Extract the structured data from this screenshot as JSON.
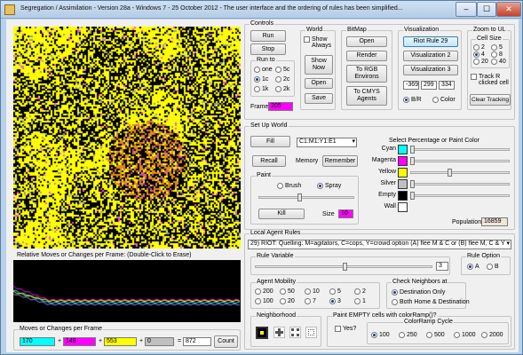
{
  "window": {
    "title": "Segregation / Assimilation - Version 28a - Windows 7 - 25 October 2012 - The user interface and the ordering of rules has been simplified...",
    "minimize": "–",
    "maximize": "☐",
    "close": "✕"
  },
  "graph": {
    "label": "Relative Moves or Changes per Frame:  (Double-Click to Erase)"
  },
  "moves": {
    "label": "Moves or Changes per Frame",
    "v1": "170",
    "plus1": "+",
    "v2": "149",
    "plus2": "+",
    "v3": "553",
    "plus3": "+",
    "v4": "0",
    "equals": "=",
    "total": "872",
    "count_label": "Count"
  },
  "controls": {
    "label": "Controls",
    "run": "Run",
    "stop": "Stop",
    "run_to_label": "Run to",
    "run_to": [
      "one",
      "5c",
      "1c",
      "2c",
      "1k",
      "2k"
    ],
    "frame_label": "Frame",
    "frame_value": "205",
    "world_label": "World",
    "show_always": "Show Always",
    "show_now": "Show Now",
    "open": "Open",
    "save": "Save",
    "bitmap_label": "BitMap",
    "bm_open": "Open",
    "bm_render": "Render",
    "to_rgb": "To RGB Environs",
    "to_cmys": "To CMYS Agents",
    "viz_label": "Visualization",
    "riot": "Riot Rule 29",
    "viz2": "Visualization 2",
    "viz3": "Visualization 3",
    "n1": "-369",
    "n2": "299",
    "n3": "334",
    "bw": "B/R",
    "color": "Color",
    "zoom_label": "Zoom to UL",
    "cell_size_label": "Cell Size",
    "cell_sizes": [
      "2",
      "5",
      "4",
      "8",
      "20",
      "40"
    ],
    "track_r": "Track R clicked cell",
    "clear_tracking": "Clear Tracking"
  },
  "setup": {
    "label": "Set Up World",
    "fill": "Fill",
    "fill_value": "C1:M1:Y1:E1",
    "recall": "Recall",
    "memory": "Memory",
    "remember": "Remember",
    "paint_label": "Paint",
    "brush": "Brush",
    "spray": "Spray",
    "kill": "Kill",
    "size_label": "Size",
    "size_value": "10",
    "select_label": "Select Percentage or Paint Color",
    "colors": [
      {
        "name": "Cyan",
        "hex": "#00ffff",
        "level": 0.0
      },
      {
        "name": "Magenta",
        "hex": "#ff00ff",
        "level": 0.0
      },
      {
        "name": "Yellow",
        "hex": "#ffff00",
        "level": 0.4
      },
      {
        "name": "Silver",
        "hex": "#c0c0c0",
        "level": 0.0
      },
      {
        "name": "Empty",
        "hex": "#000000",
        "level": 0.0
      },
      {
        "name": "Wall",
        "hex": "#ffffff",
        "level": null
      }
    ],
    "population_label": "Population",
    "population_value": "16859"
  },
  "local": {
    "label": "Local Agent Rules",
    "rule_text": "29) RIOT:  Quelling:  M=agitators,  C=cops,  Y=crowd option (A) flee M & C or (B) flee M, C & Y",
    "rule_var_label": "Rule Variable",
    "rule_var_value": "3",
    "rule_option_label": "Rule Option",
    "opt_a": "A",
    "opt_b": "B",
    "mobility_label": "Agent Mobility",
    "mobility": [
      "200",
      "50",
      "10",
      "5",
      "2",
      "100",
      "20",
      "7",
      "3",
      "1"
    ],
    "neighbors_label": "Check Neighbors at",
    "dest_only": "Destination Only",
    "both": "Both Home & Destination",
    "neighborhood_label": "Neighborhood",
    "paint_empty_label": "Paint EMPTY cells with colorRamp()?",
    "yes": "Yes?",
    "ramp_label": "ColorRamp Cycle",
    "ramp": [
      "100",
      "250",
      "500",
      "1000",
      "2000"
    ]
  }
}
